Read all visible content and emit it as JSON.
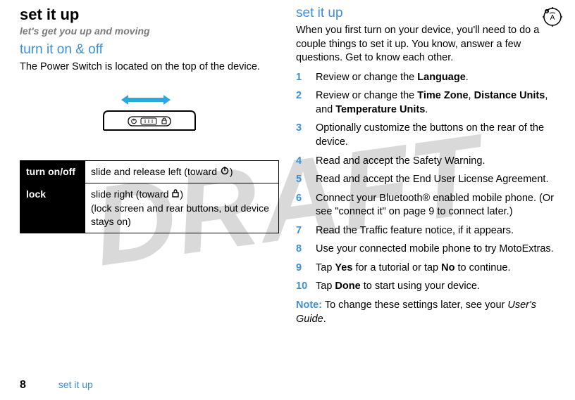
{
  "watermark": "DRAFT",
  "left": {
    "title": "set it up",
    "subtitle": "let's get you up and moving",
    "section": "turn it on & off",
    "intro": "The Power Switch is located on the top of the device.",
    "table": {
      "row1_label": "turn on/off",
      "row1_desc_pre": "slide and release left (toward ",
      "row1_desc_post": ")",
      "row2_label": "lock",
      "row2_desc_pre": "slide right (toward ",
      "row2_desc_mid": ")",
      "row2_desc_line2": "(lock screen and rear buttons, but device stays on)"
    }
  },
  "right": {
    "section": "set it up",
    "intro": "When you first turn on your device, you'll need to do a couple things to set it up. You know, answer a few questions. Get to know each other.",
    "steps": {
      "s1_pre": "Review or change the ",
      "s1_b1": "Language",
      "s1_post": ".",
      "s2_pre": "Review or change the ",
      "s2_b1": "Time Zone",
      "s2_sep1": ", ",
      "s2_b2": "Distance Units",
      "s2_sep2": ", and ",
      "s2_b3": "Temperature Units",
      "s2_post": ".",
      "s3": "Optionally customize the buttons on the rear of the device.",
      "s4": "Read and accept the Safety Warning.",
      "s5": "Read and accept the End User License Agreement.",
      "s6": "Connect your Bluetooth® enabled mobile phone. (Or see \"connect it\" on page 9 to connect later.)",
      "s7": "Read the Traffic feature notice, if it appears.",
      "s8": "Use your connected mobile phone to try MotoExtras.",
      "s9_pre": "Tap ",
      "s9_b1": "Yes",
      "s9_mid": " for a tutorial or tap ",
      "s9_b2": "No",
      "s9_post": " to continue.",
      "s10_pre": "Tap ",
      "s10_b1": "Done",
      "s10_post": " to start using your device."
    },
    "note_label": "Note:",
    "note_text": " To change these settings later, see your ",
    "note_ug": "User's Guide",
    "note_end": "."
  },
  "footer": {
    "page": "8",
    "section": "set it up"
  }
}
